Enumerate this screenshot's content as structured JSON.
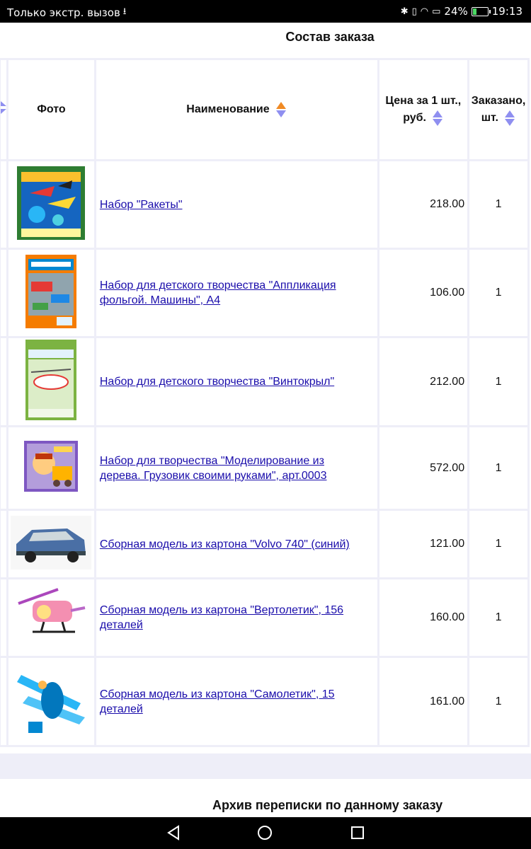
{
  "status_bar": {
    "carrier": "Только экстр. вызов",
    "battery": "24%",
    "time": "19:13",
    "battery_level": 0.24
  },
  "page": {
    "title": "Состав заказа",
    "archive_title": "Архив переписки по данному заказу"
  },
  "table": {
    "headers": {
      "photo": "Фото",
      "name": "Наименование",
      "price_line1": "Цена за 1 шт.,",
      "price_line2": "руб.",
      "qty_line1": "Заказано,",
      "qty_line2": "шт."
    },
    "rows": [
      {
        "name": "Набор \"Ракеты\"",
        "name_line2": "",
        "price": "218.00",
        "qty": "1",
        "image": "rockets-kit-image"
      },
      {
        "name": "Набор для детского творчества \"Аппликация",
        "name_line2": "фольгой. Машины\", А4",
        "price": "106.00",
        "qty": "1",
        "image": "foil-applique-cars-image"
      },
      {
        "name": "Набор для детского творчества \"Винтокрыл\"",
        "name_line2": "",
        "price": "212.00",
        "qty": "1",
        "image": "helicopter-kit-image"
      },
      {
        "name": "Набор для творчества \"Моделирование из",
        "name_line2": "дерева. Грузовик своими руками\", арт.0003",
        "price": "572.00",
        "qty": "1",
        "image": "wooden-truck-kit-image"
      },
      {
        "name": "Сборная модель из картона \"Volvo 740\" (синий)",
        "name_line2": "",
        "price": "121.00",
        "qty": "1",
        "image": "volvo-740-model-image"
      },
      {
        "name": "Сборная модель из картона \"Вертолетик\", 156",
        "name_line2": "деталей",
        "price": "160.00",
        "qty": "1",
        "image": "helicopter-model-image"
      },
      {
        "name": "Сборная модель из картона \"Самолетик\", 15",
        "name_line2": "деталей",
        "price": "161.00",
        "qty": "1",
        "image": "biplane-model-image"
      }
    ]
  },
  "colors": {
    "link": "#1a0dab",
    "table_border": "#eeeef8",
    "sort_active": "#f08a24",
    "sort_inactive": "#8f8ff0"
  }
}
